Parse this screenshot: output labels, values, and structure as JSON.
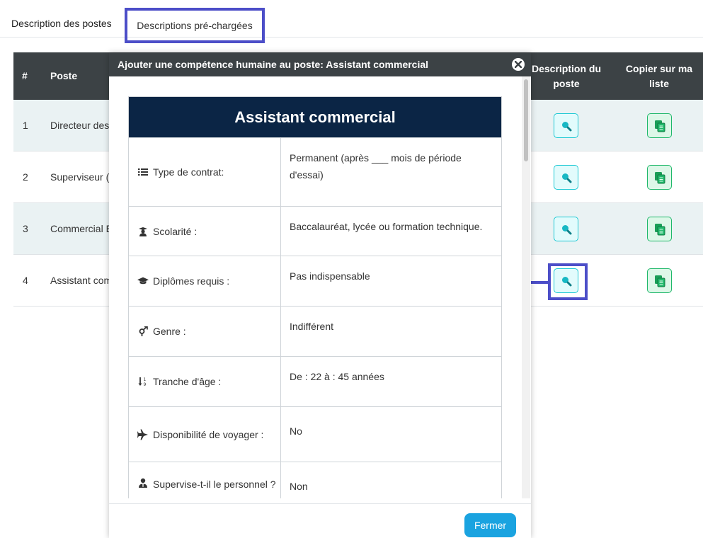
{
  "tabs": [
    {
      "label": "Description des postes"
    },
    {
      "label": "Descriptions pré-chargées"
    }
  ],
  "table": {
    "headers": {
      "num": "#",
      "poste": "Poste",
      "desc": "Description du poste",
      "copy": "Copier sur ma liste"
    },
    "rows": [
      {
        "num": "1",
        "poste": "Directeur des"
      },
      {
        "num": "2",
        "poste": "Superviseur ("
      },
      {
        "num": "3",
        "poste": "Commercial E"
      },
      {
        "num": "4",
        "poste": "Assistant com"
      }
    ]
  },
  "modal": {
    "title": "Ajouter une compétence humaine au poste: Assistant commercial",
    "card_title": "Assistant commercial",
    "details": [
      {
        "label": "Type de contrat:",
        "value": "Permanent (après ___ mois de période d'essai)",
        "icon": "list-icon"
      },
      {
        "label": "Scolarité :",
        "value": "Baccalauréat, lycée ou formation technique.",
        "icon": "student-icon"
      },
      {
        "label": "Diplômes requis :",
        "value": "Pas indispensable",
        "icon": "graduation-cap-icon"
      },
      {
        "label": "Genre :",
        "value": "Indifférent",
        "icon": "gender-icon"
      },
      {
        "label": "Tranche d'âge :",
        "value": "De : 22 à : 45 années",
        "icon": "sort-numeric-icon"
      },
      {
        "label": "Disponibilité de voyager :",
        "value": "No",
        "icon": "plane-icon"
      },
      {
        "label": "Supervise-t-il le personnel ?",
        "value": "Non",
        "icon": "user-tie-icon"
      }
    ],
    "close_button": "Fermer"
  },
  "colors": {
    "accent": "#4c4ec8",
    "header_dark": "#3c4245",
    "card_title_bg": "#0b2545",
    "view_btn": "#1dc9d4",
    "copy_btn": "#1fb86a",
    "primary_btn": "#1aa3e0"
  }
}
